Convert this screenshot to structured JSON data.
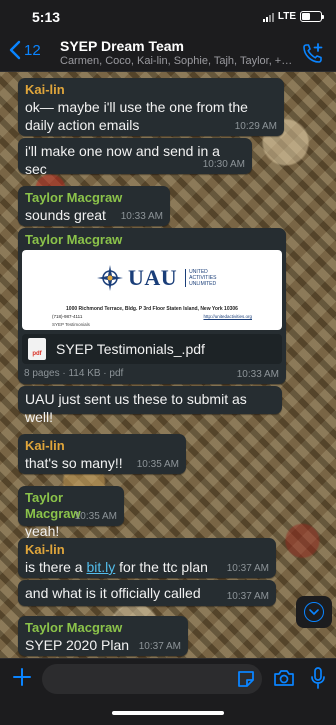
{
  "status": {
    "time": "5:13",
    "network": "LTE"
  },
  "header": {
    "back_count": "12",
    "title": "SYEP Dream Team",
    "subtitle": "Carmen, Coco, Kai-lin, Sophie, Tajh, Taylor, +1 (34..."
  },
  "messages": [
    {
      "sender": "Kai-lin",
      "text": "ok— maybe i'll use the one from the daily action emails",
      "time": "10:29 AM"
    },
    {
      "text": "i'll make one now and send in a sec",
      "time": "10:30 AM"
    },
    {
      "sender": "Taylor Macgraw",
      "text": "sounds great",
      "time": "10:33 AM"
    },
    {
      "sender": "Taylor Macgraw",
      "document": {
        "logo_text": "UAU",
        "logo_sub": [
          "UNITED",
          "ACTIVITIES",
          "UNLIMITED"
        ],
        "address": "1000 Richmond Terrace, Bldg. P 3rd Floor Staten Island, New York 10306",
        "phone": "(718)-987-4111",
        "url": "http://unitedactivities.org",
        "caption": "SYEP Testimonials",
        "file_name": "SYEP Testimonials_.pdf",
        "file_icon": "pdf",
        "meta": "8 pages · 114 KB · pdf"
      },
      "time": "10:33 AM"
    },
    {
      "text": "UAU just sent us these to submit as well!",
      "time": "10:33 AM"
    },
    {
      "sender": "Kai-lin",
      "text": "that's so many!!",
      "time": "10:35 AM"
    },
    {
      "sender": "Taylor Macgraw",
      "text": "yeah!",
      "time": "10:35 AM"
    },
    {
      "sender": "Kai-lin",
      "text_before": "is there a ",
      "link": "bit.ly",
      "text_after": " for the ttc plan",
      "time": "10:37 AM"
    },
    {
      "text": "and what is it officially called",
      "time": "10:37 AM"
    },
    {
      "sender": "Taylor Macgraw",
      "text": "SYEP 2020 Plan",
      "time": "10:37 AM"
    }
  ],
  "input": {
    "placeholder": ""
  },
  "colors": {
    "accent": "#0a84ff",
    "sender_kailin": "#e0a63b",
    "sender_taylor": "#8bc34a",
    "bubble": "#262d31",
    "link": "#53bdeb"
  },
  "icons": {
    "back": "chevron-left-icon",
    "add_call": "phone-plus-icon",
    "scroll": "chevron-down-icon",
    "plus": "plus-icon",
    "sticker": "sticker-icon",
    "camera": "camera-icon",
    "mic": "microphone-icon"
  }
}
